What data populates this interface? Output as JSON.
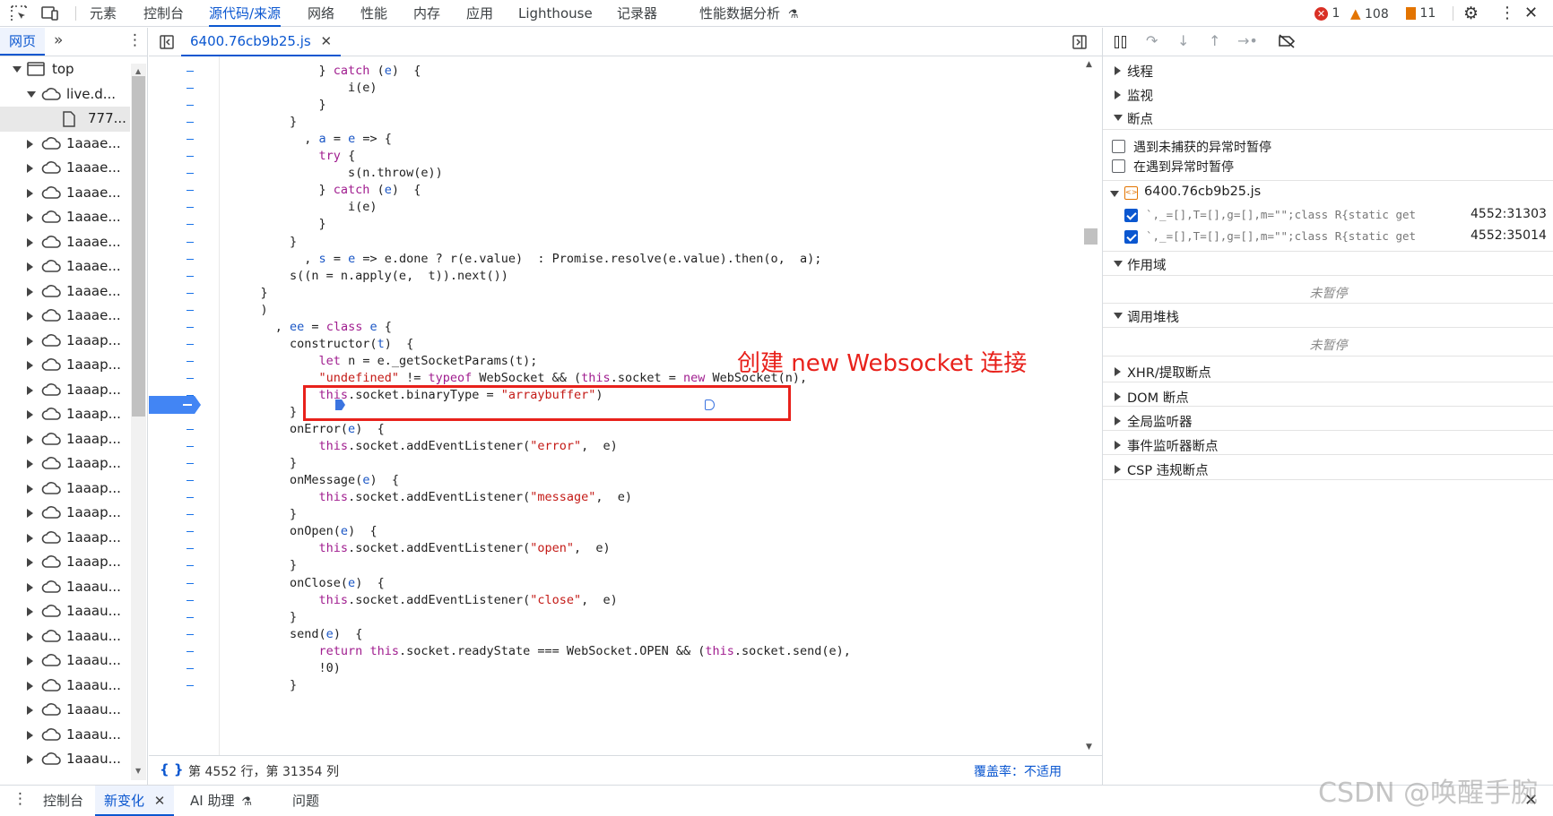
{
  "topbar": {
    "tabs": [
      "元素",
      "控制台",
      "源代码/来源",
      "网络",
      "性能",
      "内存",
      "应用",
      "Lighthouse",
      "记录器",
      "性能数据分析"
    ],
    "active_tab": "源代码/来源",
    "errors_count": "1",
    "warnings_count": "108",
    "issues_count": "11"
  },
  "navigator": {
    "tab_label": "网页",
    "tree": [
      {
        "label": "top",
        "icon": "frame-icon",
        "state": "open"
      },
      {
        "label": "live.d...",
        "icon": "cloud-icon",
        "state": "open"
      },
      {
        "label": "777...",
        "icon": "file-icon",
        "state": "leaf"
      },
      {
        "label": "1aaae...",
        "icon": "cloud-icon",
        "state": "closed"
      },
      {
        "label": "1aaae...",
        "icon": "cloud-icon",
        "state": "closed"
      },
      {
        "label": "1aaae...",
        "icon": "cloud-icon",
        "state": "closed"
      },
      {
        "label": "1aaae...",
        "icon": "cloud-icon",
        "state": "closed"
      },
      {
        "label": "1aaae...",
        "icon": "cloud-icon",
        "state": "closed"
      },
      {
        "label": "1aaae...",
        "icon": "cloud-icon",
        "state": "closed"
      },
      {
        "label": "1aaae...",
        "icon": "cloud-icon",
        "state": "closed"
      },
      {
        "label": "1aaae...",
        "icon": "cloud-icon",
        "state": "closed"
      },
      {
        "label": "1aaap...",
        "icon": "cloud-icon",
        "state": "closed"
      },
      {
        "label": "1aaap...",
        "icon": "cloud-icon",
        "state": "closed"
      },
      {
        "label": "1aaap...",
        "icon": "cloud-icon",
        "state": "closed"
      },
      {
        "label": "1aaap...",
        "icon": "cloud-icon",
        "state": "closed"
      },
      {
        "label": "1aaap...",
        "icon": "cloud-icon",
        "state": "closed"
      },
      {
        "label": "1aaap...",
        "icon": "cloud-icon",
        "state": "closed"
      },
      {
        "label": "1aaap...",
        "icon": "cloud-icon",
        "state": "closed"
      },
      {
        "label": "1aaap...",
        "icon": "cloud-icon",
        "state": "closed"
      },
      {
        "label": "1aaap...",
        "icon": "cloud-icon",
        "state": "closed"
      },
      {
        "label": "1aaap...",
        "icon": "cloud-icon",
        "state": "closed"
      },
      {
        "label": "1aaau...",
        "icon": "cloud-icon",
        "state": "closed"
      },
      {
        "label": "1aaau...",
        "icon": "cloud-icon",
        "state": "closed"
      },
      {
        "label": "1aaau...",
        "icon": "cloud-icon",
        "state": "closed"
      },
      {
        "label": "1aaau...",
        "icon": "cloud-icon",
        "state": "closed"
      },
      {
        "label": "1aaau...",
        "icon": "cloud-icon",
        "state": "closed"
      },
      {
        "label": "1aaau...",
        "icon": "cloud-icon",
        "state": "closed"
      },
      {
        "label": "1aaau...",
        "icon": "cloud-icon",
        "state": "closed"
      },
      {
        "label": "1aaau...",
        "icon": "cloud-icon",
        "state": "closed"
      }
    ]
  },
  "editor": {
    "file_tab": "6400.76cb9b25.js",
    "annotation": "创建 new Websocket 连接",
    "status_position": "第 4552 行，第 31354 列",
    "coverage": "覆盖率：不适用",
    "lines": [
      [
        [
          "            } ",
          ""
        ],
        [
          "catch",
          "kw"
        ],
        [
          " (",
          ""
        ],
        [
          "e",
          "var"
        ],
        [
          ")  {",
          ""
        ]
      ],
      [
        [
          "                i(e)",
          ""
        ]
      ],
      [
        [
          "            }",
          ""
        ]
      ],
      [
        [
          "        }",
          ""
        ]
      ],
      [
        [
          "          , ",
          ""
        ],
        [
          "a",
          "var"
        ],
        [
          " = ",
          ""
        ],
        [
          "e",
          "var"
        ],
        [
          " => {",
          ""
        ]
      ],
      [
        [
          "            ",
          ""
        ],
        [
          "try",
          "kw"
        ],
        [
          " {",
          ""
        ]
      ],
      [
        [
          "                s(n.throw(e))",
          ""
        ]
      ],
      [
        [
          "            } ",
          ""
        ],
        [
          "catch",
          "kw"
        ],
        [
          " (",
          ""
        ],
        [
          "e",
          "var"
        ],
        [
          ")  {",
          ""
        ]
      ],
      [
        [
          "                i(e)",
          ""
        ]
      ],
      [
        [
          "            }",
          ""
        ]
      ],
      [
        [
          "        }",
          ""
        ]
      ],
      [
        [
          "          , ",
          ""
        ],
        [
          "s",
          "var"
        ],
        [
          " = ",
          ""
        ],
        [
          "e",
          "var"
        ],
        [
          " => e.done ? r(e.value)  : Promise.resolve(e.value).then(o,  a);",
          ""
        ]
      ],
      [
        [
          "        s((n = n.apply(e,  t)).next())",
          ""
        ]
      ],
      [
        [
          "    }",
          ""
        ]
      ],
      [
        [
          "    )",
          ""
        ]
      ],
      [
        [
          "      , ",
          ""
        ],
        [
          "ee",
          "var"
        ],
        [
          " = ",
          ""
        ],
        [
          "class",
          "kw"
        ],
        [
          " ",
          ""
        ],
        [
          "e",
          "var"
        ],
        [
          " {",
          ""
        ]
      ],
      [
        [
          "        constructor(",
          ""
        ],
        [
          "t",
          "var"
        ],
        [
          ")  {",
          ""
        ]
      ],
      [
        [
          "            ",
          ""
        ],
        [
          "let",
          "kw"
        ],
        [
          " n = e._getSocketParams(t);",
          ""
        ]
      ],
      [
        [
          "            ",
          ""
        ],
        [
          "\"undefined\"",
          "str"
        ],
        [
          " != ",
          ""
        ],
        [
          "typeof",
          "kw"
        ],
        [
          " WebSocket && (",
          ""
        ],
        [
          "this",
          "kw"
        ],
        [
          ".socket = ",
          ""
        ],
        [
          "new",
          "kw"
        ],
        [
          " WebSocket(n),",
          ""
        ]
      ],
      [
        [
          "            ",
          ""
        ],
        [
          "this",
          "kw"
        ],
        [
          ".socket.binaryType = ",
          ""
        ],
        [
          "\"arraybuffer\"",
          "str"
        ],
        [
          ")",
          ""
        ]
      ],
      [
        [
          "        }",
          ""
        ]
      ],
      [
        [
          "        onError(",
          ""
        ],
        [
          "e",
          "var"
        ],
        [
          ")  {",
          ""
        ]
      ],
      [
        [
          "            ",
          ""
        ],
        [
          "this",
          "kw"
        ],
        [
          ".socket.addEventListener(",
          ""
        ],
        [
          "\"error\"",
          "str"
        ],
        [
          ",  e)",
          ""
        ]
      ],
      [
        [
          "        }",
          ""
        ]
      ],
      [
        [
          "        onMessage(",
          ""
        ],
        [
          "e",
          "var"
        ],
        [
          ")  {",
          ""
        ]
      ],
      [
        [
          "            ",
          ""
        ],
        [
          "this",
          "kw"
        ],
        [
          ".socket.addEventListener(",
          ""
        ],
        [
          "\"message\"",
          "str"
        ],
        [
          ",  e)",
          ""
        ]
      ],
      [
        [
          "        }",
          ""
        ]
      ],
      [
        [
          "        onOpen(",
          ""
        ],
        [
          "e",
          "var"
        ],
        [
          ")  {",
          ""
        ]
      ],
      [
        [
          "            ",
          ""
        ],
        [
          "this",
          "kw"
        ],
        [
          ".socket.addEventListener(",
          ""
        ],
        [
          "\"open\"",
          "str"
        ],
        [
          ",  e)",
          ""
        ]
      ],
      [
        [
          "        }",
          ""
        ]
      ],
      [
        [
          "        onClose(",
          ""
        ],
        [
          "e",
          "var"
        ],
        [
          ")  {",
          ""
        ]
      ],
      [
        [
          "            ",
          ""
        ],
        [
          "this",
          "kw"
        ],
        [
          ".socket.addEventListener(",
          ""
        ],
        [
          "\"close\"",
          "str"
        ],
        [
          ",  e)",
          ""
        ]
      ],
      [
        [
          "        }",
          ""
        ]
      ],
      [
        [
          "        send(",
          ""
        ],
        [
          "e",
          "var"
        ],
        [
          ")  {",
          ""
        ]
      ],
      [
        [
          "            ",
          ""
        ],
        [
          "return",
          "kw"
        ],
        [
          " ",
          ""
        ],
        [
          "this",
          "kw"
        ],
        [
          ".socket.readyState === WebSocket.OPEN && (",
          ""
        ],
        [
          "this",
          "kw"
        ],
        [
          ".socket.send(e),",
          ""
        ]
      ],
      [
        [
          "            !0)",
          ""
        ]
      ],
      [
        [
          "        }",
          ""
        ]
      ]
    ]
  },
  "debugger": {
    "sections": {
      "threads": "线程",
      "watch": "监视",
      "breakpoints": "断点",
      "scope": "作用域",
      "callstack": "调用堆栈",
      "xhr": "XHR/提取断点",
      "dom": "DOM 断点",
      "global": "全局监听器",
      "event": "事件监听器断点",
      "csp": "CSP 违规断点"
    },
    "pause_uncaught": "遇到未捕获的异常时暂停",
    "pause_caught": "在遇到异常时暂停",
    "bp_file": "6400.76cb9b25.js",
    "bp_items": [
      {
        "code": "`,_=[],T=[],g=[],m=\"\";class R{static getG…",
        "loc": "4552:31303"
      },
      {
        "code": "`,_=[],T=[],g=[],m=\"\";class R{static getG…",
        "loc": "4552:35014"
      }
    ],
    "not_paused": "未暂停"
  },
  "drawer": {
    "tabs": [
      "控制台",
      "新变化",
      "AI 助理",
      "问题"
    ],
    "active_tab": "新变化"
  },
  "watermark": "CSDN @唤醒手腕",
  "colors": {
    "accent": "#0b57d0",
    "annotation": "#e8211b",
    "keyword": "#a01d8f",
    "string": "#c41a16"
  }
}
